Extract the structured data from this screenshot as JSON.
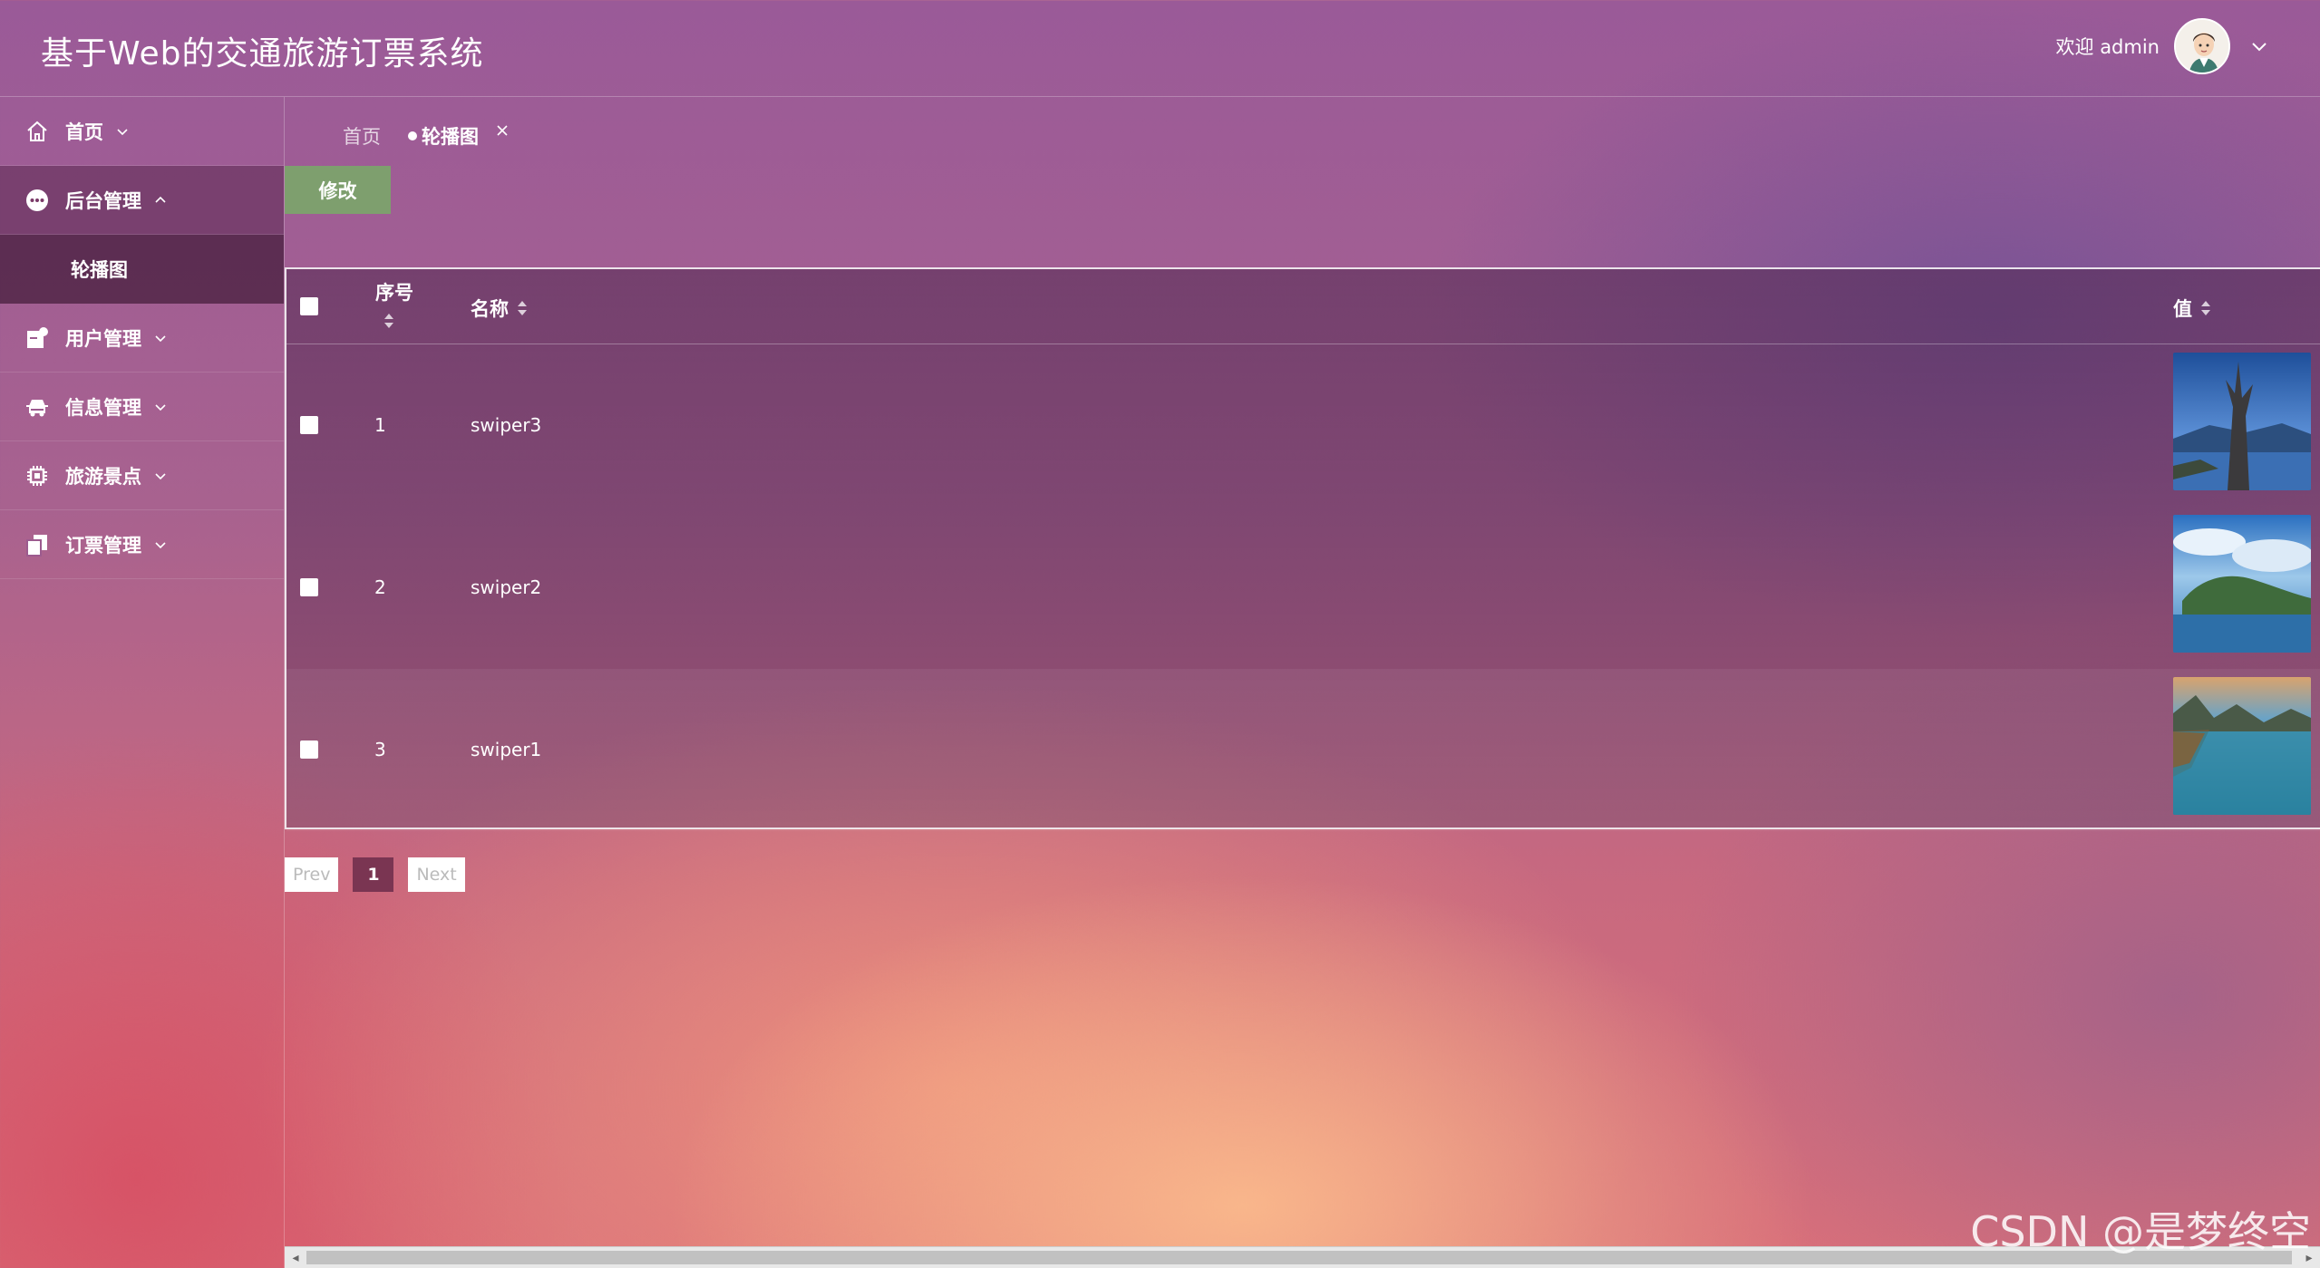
{
  "header": {
    "title": "基于Web的交通旅游订票系统",
    "welcome": "欢迎 admin"
  },
  "sidebar": {
    "items": [
      {
        "label": "首页",
        "icon": "home-icon"
      },
      {
        "label": "后台管理",
        "icon": "more-circle-icon",
        "open": true,
        "children": [
          {
            "label": "轮播图"
          }
        ]
      },
      {
        "label": "用户管理",
        "icon": "user-card-icon"
      },
      {
        "label": "信息管理",
        "icon": "car-icon"
      },
      {
        "label": "旅游景点",
        "icon": "chip-icon"
      },
      {
        "label": "订票管理",
        "icon": "copy-icon"
      }
    ]
  },
  "tabs": {
    "home": "首页",
    "active": "轮播图"
  },
  "toolbar": {
    "edit_label": "修改"
  },
  "table": {
    "columns": [
      "序号",
      "名称",
      "值"
    ],
    "rows": [
      {
        "index": "1",
        "name": "swiper3",
        "image": "landscape-lake-tree"
      },
      {
        "index": "2",
        "name": "swiper2",
        "image": "landscape-lake-island"
      },
      {
        "index": "3",
        "name": "swiper1",
        "image": "landscape-lake-shore"
      }
    ]
  },
  "pagination": {
    "prev": "Prev",
    "current": "1",
    "next": "Next"
  },
  "watermark": "CSDN @是梦终空",
  "colors": {
    "edit_button": "#7e9f6e",
    "current_page": "#7a3552"
  }
}
